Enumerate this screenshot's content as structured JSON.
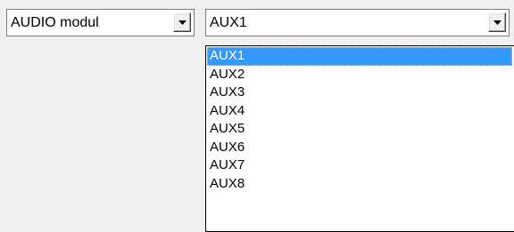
{
  "module_select": {
    "value": "AUDIO modul"
  },
  "channel_select": {
    "value": "AUX1",
    "options": [
      "AUX1",
      "AUX2",
      "AUX3",
      "AUX4",
      "AUX5",
      "AUX6",
      "AUX7",
      "AUX8"
    ],
    "selected_index": 0
  },
  "colors": {
    "background": "#f0f0f0",
    "highlight": "#3399ff",
    "highlight_text": "#ffffff"
  },
  "icons": {
    "dropdown_arrow": "chevron-down-icon"
  }
}
